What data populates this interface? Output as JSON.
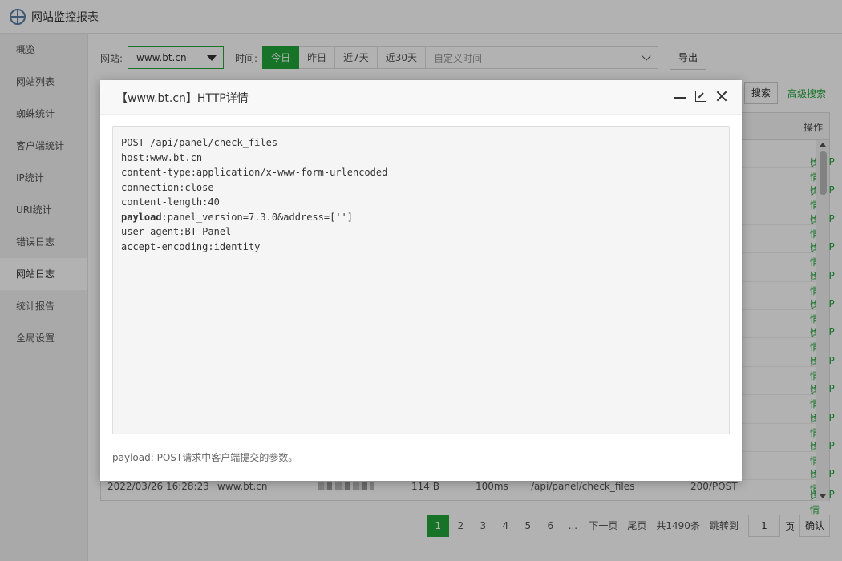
{
  "app": {
    "title": "网站监控报表"
  },
  "sidebar": {
    "items": [
      {
        "label": "概览"
      },
      {
        "label": "网站列表"
      },
      {
        "label": "蜘蛛统计"
      },
      {
        "label": "客户端统计"
      },
      {
        "label": "IP统计"
      },
      {
        "label": "URI统计"
      },
      {
        "label": "错误日志"
      },
      {
        "label": "网站日志"
      },
      {
        "label": "统计报告"
      },
      {
        "label": "全局设置"
      }
    ],
    "active": "网站日志"
  },
  "filter": {
    "site_label": "网站:",
    "site_value": "www.bt.cn",
    "time_label": "时间:",
    "time_buttons": [
      "今日",
      "昨日",
      "近7天",
      "近30天"
    ],
    "time_active": "今日",
    "custom_time": "自定义时间",
    "export": "导出"
  },
  "search": {
    "button": "搜索",
    "advanced": "高级搜索"
  },
  "table": {
    "op_header": "操作",
    "op_http": "HTTP",
    "op_sep": "|",
    "op_detail": "详情",
    "last_row": {
      "time": "2022/03/26 16:28:23",
      "site": "www.bt.cn",
      "size": "114 B",
      "duration": "100ms",
      "uri": "/api/panel/check_files",
      "status": "200/POST"
    }
  },
  "pager": {
    "pages": [
      "1",
      "2",
      "3",
      "4",
      "5",
      "6",
      "..."
    ],
    "next": "下一页",
    "last": "尾页",
    "total": "共1490条",
    "jump": "跳转到",
    "jump_value": "1",
    "page_unit": "页",
    "confirm": "确认"
  },
  "modal": {
    "title": "【www.bt.cn】HTTP详情",
    "lines": [
      {
        "key": "POST /api/panel/check_files",
        "value": ""
      },
      {
        "key": "host:",
        "value": "www.bt.cn"
      },
      {
        "key": "content-type:",
        "value": "application/x-www-form-urlencoded"
      },
      {
        "key": "connection:",
        "value": "close"
      },
      {
        "key": "content-length:",
        "value": "40"
      },
      {
        "key": "payload",
        "value": ":panel_version=7.3.0&address=['']"
      },
      {
        "key": "user-agent:",
        "value": "BT-Panel"
      },
      {
        "key": "accept-encoding:",
        "value": "identity"
      }
    ],
    "note": "payload: POST请求中客户端提交的参数。"
  },
  "colors": {
    "accent": "#20a53a"
  }
}
